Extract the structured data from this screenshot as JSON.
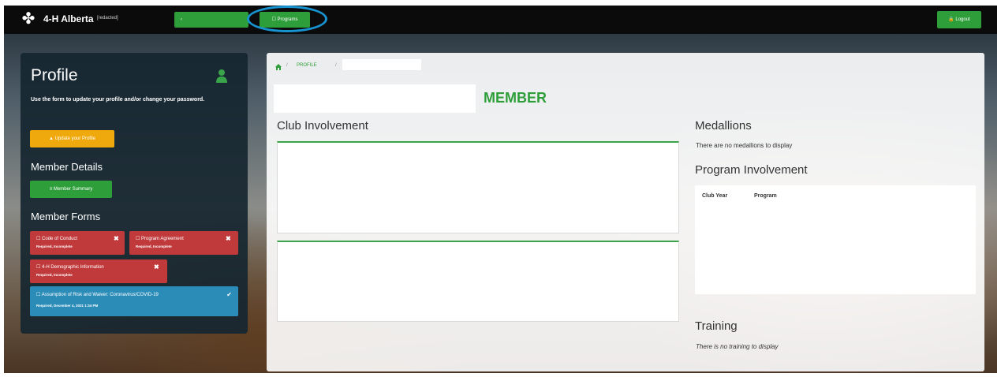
{
  "topbar": {
    "brand": "4-H Alberta",
    "brand_sub": "[redacted]",
    "nav_green_label": "‹",
    "programs_label": "☐ Programs",
    "logout_label": "🔒 Logout"
  },
  "profile": {
    "title": "Profile",
    "description": "Use the form to update your profile and/or change your password.",
    "update_button": "▲ Update your Profile",
    "member_details_heading": "Member Details",
    "member_summary_button": "≡ Member Summary",
    "member_forms_heading": "Member Forms",
    "forms": [
      {
        "title": "☐ Code of Conduct",
        "status": "Required, Incomplete"
      },
      {
        "title": "☐ Program Agreement",
        "status": "Required, Incomplete"
      },
      {
        "title": "☐ 4-H Demographic Information",
        "status": "Required, Incomplete"
      },
      {
        "title": "☐ Assumption of Risk and Waiver: Coronavirus/COVID-19",
        "status": "Required, December 4, 2021 1:34 PM"
      }
    ]
  },
  "main": {
    "breadcrumb": [
      "PROFILE"
    ],
    "member_label": "MEMBER",
    "club_heading": "Club Involvement",
    "medallions_heading": "Medallions",
    "medallions_empty": "There are no medallions to display",
    "program_heading": "Program Involvement",
    "program_columns": [
      "Club Year",
      "Program"
    ],
    "training_heading": "Training",
    "training_empty": "There is no training to display"
  },
  "colors": {
    "green": "#2e9e3a",
    "orange": "#f0a90d",
    "red": "#c0393b",
    "blue": "#2b8cb8",
    "highlight": "#1793d1"
  }
}
